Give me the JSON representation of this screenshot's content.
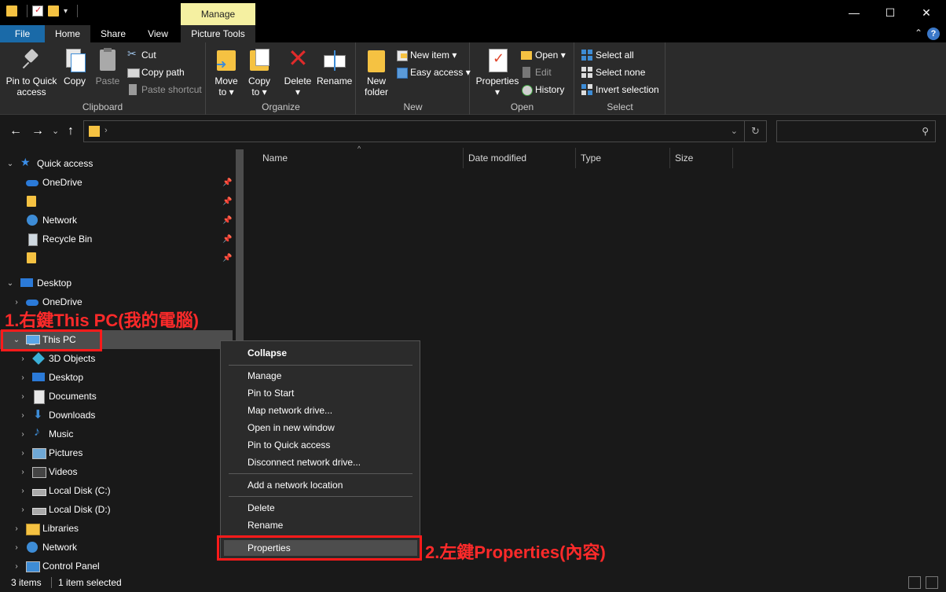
{
  "title_bar": {
    "contextual_tab": "Manage"
  },
  "ribbon_tabs": {
    "file": "File",
    "home": "Home",
    "share": "Share",
    "view": "View",
    "picture_tools": "Picture Tools"
  },
  "window_controls": {
    "minimize": "—",
    "maximize": "☐",
    "close": "✕"
  },
  "ribbon": {
    "clipboard": {
      "label": "Clipboard",
      "pin_line1": "Pin to Quick",
      "pin_line2": "access",
      "copy": "Copy",
      "paste": "Paste",
      "cut": "Cut",
      "copy_path": "Copy path",
      "paste_shortcut": "Paste shortcut"
    },
    "organize": {
      "label": "Organize",
      "move_line1": "Move",
      "move_line2": "to ▾",
      "copy_line1": "Copy",
      "copy_line2": "to ▾",
      "delete": "Delete",
      "delete_arrow": "▾",
      "rename": "Rename"
    },
    "new": {
      "label": "New",
      "new_folder_line1": "New",
      "new_folder_line2": "folder",
      "new_item": "New item ▾",
      "easy_access": "Easy access ▾"
    },
    "open": {
      "label": "Open",
      "properties": "Properties",
      "properties_arrow": "▾",
      "open": "Open ▾",
      "edit": "Edit",
      "history": "History"
    },
    "select": {
      "label": "Select",
      "select_all": "Select all",
      "select_none": "Select none",
      "invert_selection": "Invert selection"
    }
  },
  "navigation": {
    "back": "←",
    "forward": "→",
    "recent": "⌄",
    "up": "↑",
    "address_chevron": "›",
    "address_dropdown": "⌄",
    "refresh": "↻",
    "search_icon": "⚲"
  },
  "nav_pane": {
    "quick_access": "Quick access",
    "qa_onedrive": "OneDrive",
    "qa_network": "Network",
    "qa_recycle": "Recycle Bin",
    "desktop": "Desktop",
    "onedrive": "OneDrive",
    "this_pc": "This PC",
    "objects_3d": "3D Objects",
    "pc_desktop": "Desktop",
    "documents": "Documents",
    "downloads": "Downloads",
    "music": "Music",
    "pictures": "Pictures",
    "videos": "Videos",
    "local_c": "Local Disk (C:)",
    "local_d": "Local Disk (D:)",
    "libraries": "Libraries",
    "network": "Network",
    "control_panel": "Control Panel"
  },
  "columns": {
    "name": "Name",
    "date_modified": "Date modified",
    "type": "Type",
    "size": "Size"
  },
  "status": {
    "items": "3 items",
    "selected": "1 item selected"
  },
  "context_menu": {
    "collapse": "Collapse",
    "manage": "Manage",
    "pin_start": "Pin to Start",
    "map_drive": "Map network drive...",
    "open_new_window": "Open in new window",
    "pin_quick": "Pin to Quick access",
    "disconnect": "Disconnect network drive...",
    "add_network_location": "Add a network location",
    "delete": "Delete",
    "rename": "Rename",
    "properties": "Properties"
  },
  "annotations": {
    "step1": "1.右鍵This PC(我的電腦)",
    "step2": "2.左鍵Properties(內容)"
  }
}
